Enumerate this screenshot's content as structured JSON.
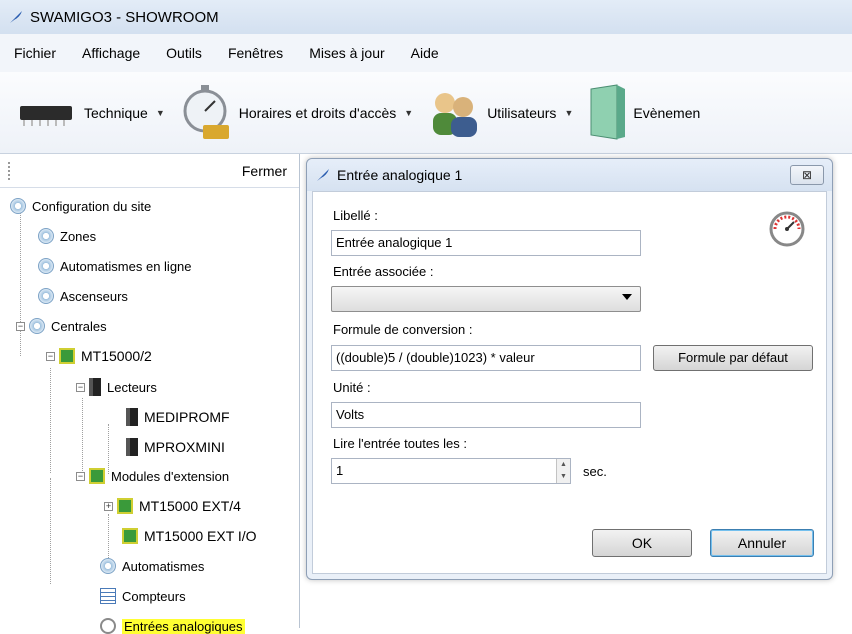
{
  "window": {
    "title": "SWAMIGO3 - SHOWROOM",
    "icon": "feather-icon"
  },
  "menu": [
    "Fichier",
    "Affichage",
    "Outils",
    "Fenêtres",
    "Mises à jour",
    "Aide"
  ],
  "toolbar": [
    {
      "label": "Technique",
      "icon": "chip-icon"
    },
    {
      "label": "Horaires et droits d'accès",
      "icon": "stopwatch-icon"
    },
    {
      "label": "Utilisateurs",
      "icon": "users-icon"
    },
    {
      "label": "Evènemen",
      "icon": "door-icon"
    }
  ],
  "panel": {
    "close_label": "Fermer",
    "tree": [
      {
        "label": "Configuration du site",
        "icon": "gear-icon"
      },
      {
        "label": "Zones",
        "icon": "gear-icon"
      },
      {
        "label": "Automatismes en ligne",
        "icon": "gear-icon"
      },
      {
        "label": "Ascenseurs",
        "icon": "gear-icon"
      },
      {
        "label": "Centrales",
        "icon": "gear-icon"
      },
      {
        "label": "MT15000/2",
        "icon": "chip-icon"
      },
      {
        "label": "Lecteurs",
        "icon": "reader-icon"
      },
      {
        "label": "MEDIPROMF",
        "icon": "reader-icon"
      },
      {
        "label": "MPROXMINI",
        "icon": "reader-icon"
      },
      {
        "label": "Modules d'extension",
        "icon": "chip-icon"
      },
      {
        "label": "MT15000 EXT/4",
        "icon": "chip-icon"
      },
      {
        "label": "MT15000 EXT I/O",
        "icon": "chip-icon"
      },
      {
        "label": "Automatismes",
        "icon": "gear-icon"
      },
      {
        "label": "Compteurs",
        "icon": "counter-icon"
      },
      {
        "label": "Entrées analogiques",
        "icon": "gauge-icon"
      }
    ]
  },
  "dialog": {
    "title": "Entrée analogique 1",
    "close_glyph": "⊠",
    "libelle_label": "Libellé :",
    "libelle_value": "Entrée analogique 1",
    "entree_label": "Entrée associée :",
    "entree_value": "",
    "formule_label": "Formule de conversion :",
    "formule_value": "((double)5 / (double)1023) * valeur",
    "formule_default_button": "Formule par défaut",
    "unite_label": "Unité :",
    "unite_value": "Volts",
    "lire_label": "Lire l'entrée toutes les :",
    "lire_value": "1",
    "lire_unit": "sec.",
    "ok_button": "OK",
    "cancel_button": "Annuler",
    "spin_up": "▲",
    "spin_down": "▼"
  },
  "colors": {
    "selected_highlight": "#ffff33",
    "titlebar": "#d8e4f2"
  }
}
